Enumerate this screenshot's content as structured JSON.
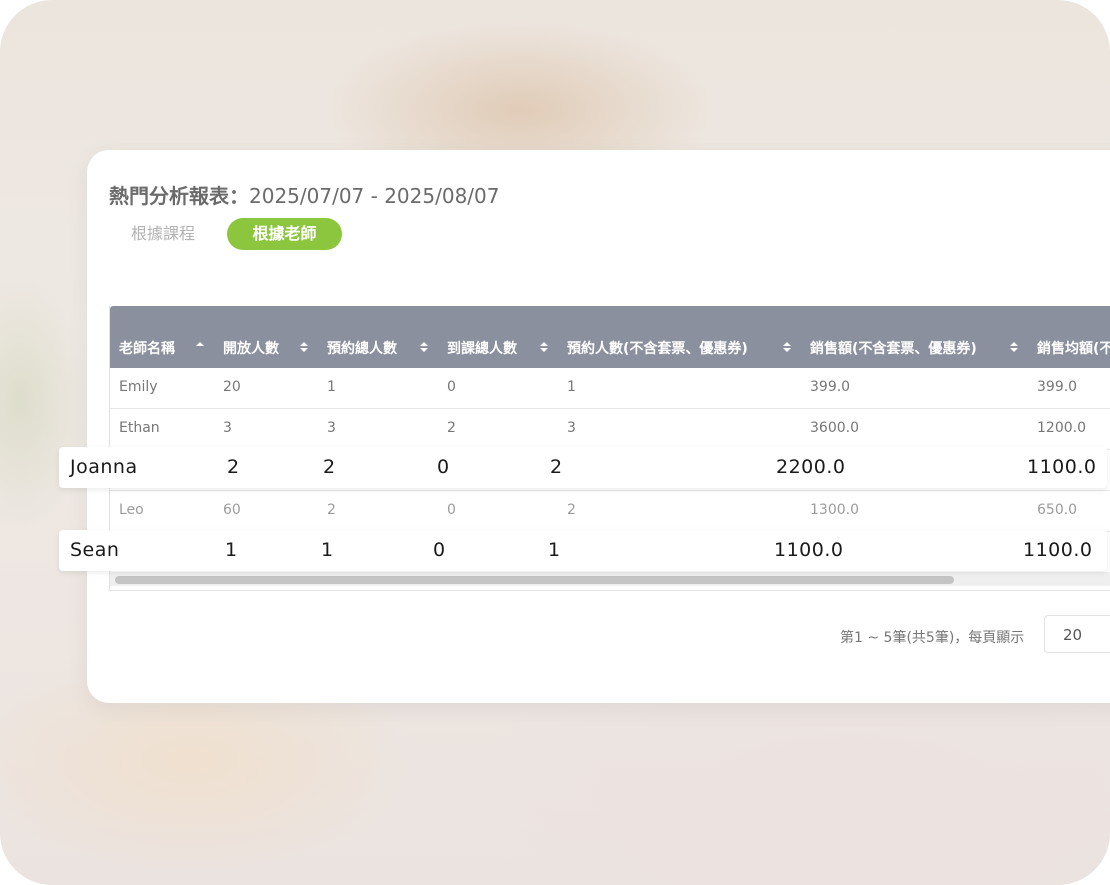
{
  "report": {
    "title_label": "熱門分析報表：",
    "date_range": "2025/07/07 - 2025/08/07"
  },
  "tabs": {
    "course": "根據課程",
    "teacher": "根據老師"
  },
  "table": {
    "columns": [
      "老師名稱",
      "開放人數",
      "預約總人數",
      "到課總人數",
      "預約人數(不含套票、優惠券)",
      "銷售額(不含套票、優惠券)",
      "銷售均額(不"
    ],
    "rows": [
      {
        "name": "Emily",
        "open": "20",
        "booked": "1",
        "attended": "0",
        "booked_excl": "1",
        "sales": "399.0",
        "avg": "399.0"
      },
      {
        "name": "Ethan",
        "open": "3",
        "booked": "3",
        "attended": "2",
        "booked_excl": "3",
        "sales": "3600.0",
        "avg": "1200.0"
      },
      {
        "name": "Joanna",
        "open": "2",
        "booked": "2",
        "attended": "0",
        "booked_excl": "2",
        "sales": "2200.0",
        "avg": "1100.0"
      },
      {
        "name": "Leo",
        "open": "60",
        "booked": "2",
        "attended": "0",
        "booked_excl": "2",
        "sales": "1300.0",
        "avg": "650.0"
      },
      {
        "name": "Sean",
        "open": "1",
        "booked": "1",
        "attended": "0",
        "booked_excl": "1",
        "sales": "1100.0",
        "avg": "1100.0"
      }
    ]
  },
  "pager": {
    "summary": "第1 ~ 5筆(共5筆)，每頁顯示",
    "page_size": "20"
  },
  "colors": {
    "accent": "#8cc63f",
    "header_bg": "#8b909e"
  }
}
